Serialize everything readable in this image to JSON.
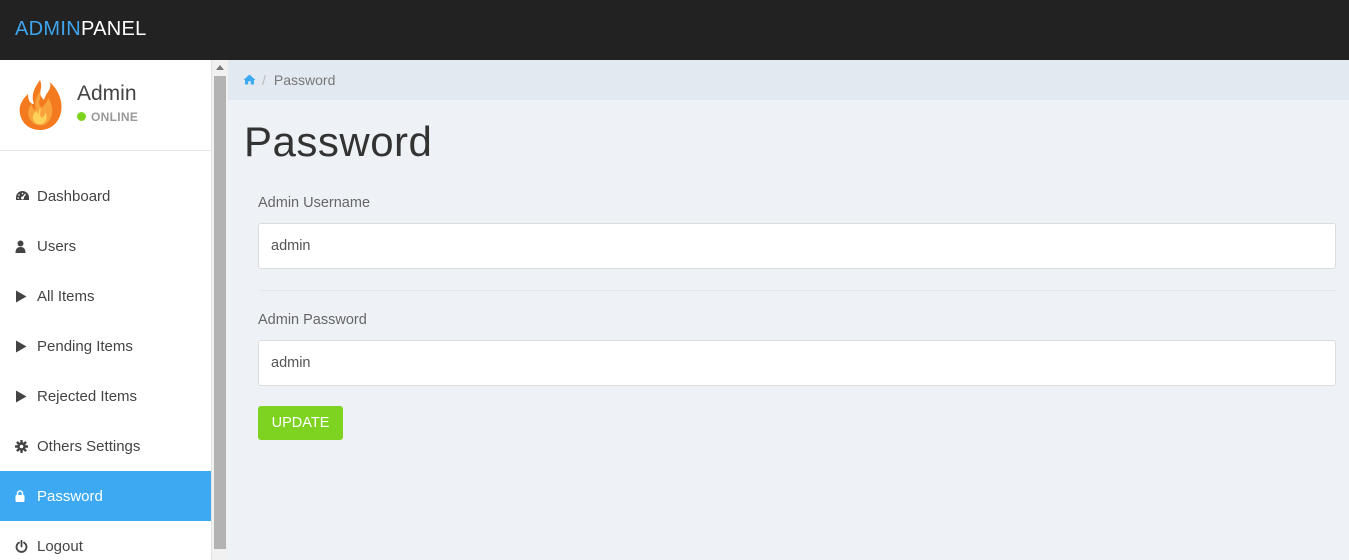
{
  "brand": {
    "part1": "ADMIN",
    "part2": "PANEL"
  },
  "profile": {
    "name": "Admin",
    "status": "ONLINE"
  },
  "sidebar": {
    "items": [
      {
        "label": "Dashboard",
        "icon": "dashboard-icon",
        "active": false
      },
      {
        "label": "Users",
        "icon": "user-icon",
        "active": false
      },
      {
        "label": "All Items",
        "icon": "play-icon",
        "active": false
      },
      {
        "label": "Pending Items",
        "icon": "play-icon",
        "active": false
      },
      {
        "label": "Rejected Items",
        "icon": "play-icon",
        "active": false
      },
      {
        "label": "Others Settings",
        "icon": "gear-icon",
        "active": false
      },
      {
        "label": "Password",
        "icon": "lock-icon",
        "active": true
      },
      {
        "label": "Logout",
        "icon": "power-icon",
        "active": false
      }
    ]
  },
  "breadcrumb": {
    "icon": "home-icon",
    "current": "Password"
  },
  "page": {
    "title": "Password"
  },
  "form": {
    "username_label": "Admin Username",
    "username_value": "admin",
    "password_label": "Admin Password",
    "password_value": "admin",
    "submit_label": "UPDATE"
  },
  "colors": {
    "accent": "#3ca9f2",
    "success": "#7ed321",
    "topbar": "#222222"
  }
}
